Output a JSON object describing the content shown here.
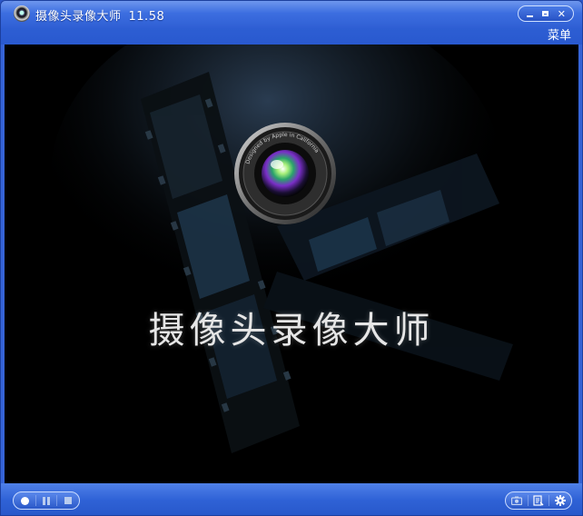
{
  "window": {
    "title": "摄像头录像大师",
    "version": "11.58"
  },
  "menu": {
    "label": "菜单"
  },
  "splash": {
    "logo_text": "摄像头录像大师",
    "lens_ring_text": "Designed by Apple in California"
  },
  "icons": {
    "app": "webcam-icon",
    "minimize": "minimize-icon",
    "maximize": "maximize-icon",
    "close": "close-icon",
    "record": "record-icon",
    "pause": "pause-icon",
    "stop": "stop-icon",
    "snapshot": "camera-icon",
    "file_list": "file-list-icon",
    "settings": "gear-icon"
  },
  "colors": {
    "chrome_blue": "#3563d6",
    "video_bg": "#000000"
  }
}
